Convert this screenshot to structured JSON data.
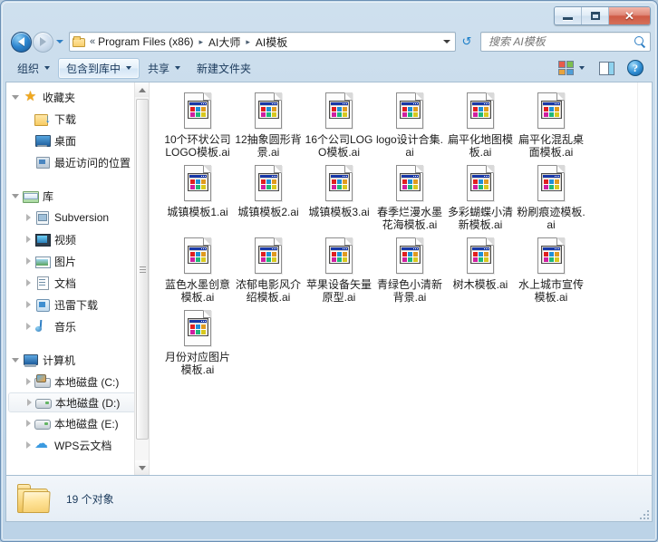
{
  "window": {
    "controls": {
      "minimize": "—",
      "maximize": "□",
      "close": "✕"
    }
  },
  "address": {
    "back_tooltip": "后退",
    "forward_tooltip": "前进",
    "overflow_chevron": "«",
    "crumbs": [
      {
        "label": "Program Files (x86)"
      },
      {
        "label": "AI大师"
      },
      {
        "label": "AI模板"
      }
    ],
    "separator": "▸",
    "refresh_glyph": "↺"
  },
  "search": {
    "placeholder": "搜索 AI模板",
    "value": ""
  },
  "toolbar": {
    "organize": "组织",
    "include_in_library": "包含到库中",
    "share": "共享",
    "new_folder": "新建文件夹",
    "help_glyph": "?"
  },
  "navpane": {
    "groups": [
      {
        "title": "收藏夹",
        "icon": "star-icon",
        "expanded": true,
        "items": [
          {
            "label": "下载",
            "icon": "downloads-icon",
            "arrow": "none"
          },
          {
            "label": "桌面",
            "icon": "desktop-icon",
            "arrow": "none"
          },
          {
            "label": "最近访问的位置",
            "icon": "recent-places-icon",
            "arrow": "none"
          }
        ]
      },
      {
        "title": "库",
        "icon": "library-icon",
        "expanded": true,
        "items": [
          {
            "label": "Subversion",
            "icon": "subversion-icon",
            "arrow": "collapsed"
          },
          {
            "label": "视频",
            "icon": "videos-icon",
            "arrow": "collapsed"
          },
          {
            "label": "图片",
            "icon": "pictures-icon",
            "arrow": "collapsed"
          },
          {
            "label": "文档",
            "icon": "documents-icon",
            "arrow": "collapsed"
          },
          {
            "label": "迅雷下载",
            "icon": "xunlei-icon",
            "arrow": "collapsed"
          },
          {
            "label": "音乐",
            "icon": "music-icon",
            "arrow": "collapsed"
          }
        ]
      },
      {
        "title": "计算机",
        "icon": "computer-icon",
        "expanded": true,
        "items": [
          {
            "label": "本地磁盘 (C:)",
            "icon": "hard-disk-system-icon",
            "arrow": "collapsed",
            "selected": false
          },
          {
            "label": "本地磁盘 (D:)",
            "icon": "hard-disk-icon",
            "arrow": "collapsed",
            "selected": true
          },
          {
            "label": "本地磁盘 (E:)",
            "icon": "hard-disk-icon",
            "arrow": "collapsed",
            "selected": false
          },
          {
            "label": "WPS云文档",
            "icon": "cloud-icon",
            "arrow": "collapsed",
            "selected": false
          }
        ]
      }
    ]
  },
  "files": [
    {
      "name": "10个环状公司LOGO模板.ai"
    },
    {
      "name": "12抽象圆形背景.ai"
    },
    {
      "name": "16个公司LOGO模板.ai"
    },
    {
      "name": "logo设计合集.ai"
    },
    {
      "name": "扁平化地图模板.ai"
    },
    {
      "name": "扁平化混乱桌面模板.ai"
    },
    {
      "name": "城镇模板1.ai"
    },
    {
      "name": "城镇模板2.ai"
    },
    {
      "name": "城镇模板3.ai"
    },
    {
      "name": "春季烂漫水墨花海模板.ai"
    },
    {
      "name": "多彩蝴蝶小清新模板.ai"
    },
    {
      "name": "粉刷痕迹模板.ai"
    },
    {
      "name": "蓝色水墨创意模板.ai"
    },
    {
      "name": "浓郁电影风介绍模板.ai"
    },
    {
      "name": "苹果设备矢量原型.ai"
    },
    {
      "name": "青绿色小清新背景.ai"
    },
    {
      "name": "树木模板.ai"
    },
    {
      "name": "水上城市宣传模板.ai"
    },
    {
      "name": "月份对应图片模板.ai"
    }
  ],
  "statusbar": {
    "item_count": "19 个对象"
  },
  "colors": {
    "frame": "#bcd3e7",
    "accent_blue": "#2f7fc4",
    "close_red": "#cf5a44",
    "selection": "#eef2f6",
    "text": "#1c1c1c"
  }
}
